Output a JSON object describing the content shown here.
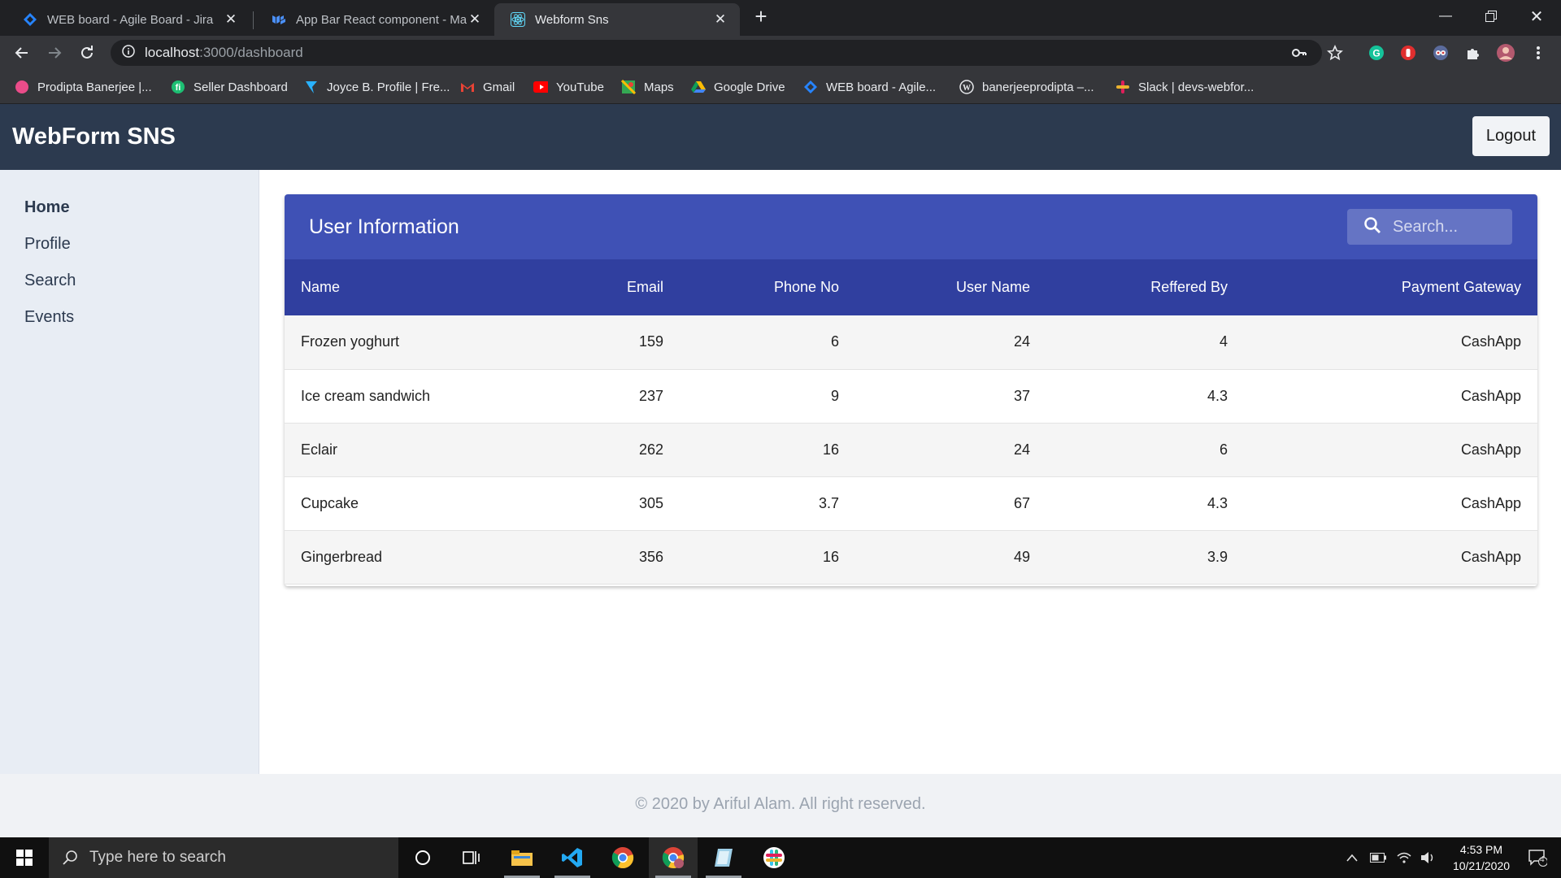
{
  "browser": {
    "tabs": [
      {
        "title": "WEB board - Agile Board - Jira",
        "icon": "jira-icon",
        "active": false
      },
      {
        "title": "App Bar React component - Mat",
        "icon": "material-ui-icon",
        "active": false
      },
      {
        "title": "Webform Sns",
        "icon": "react-icon",
        "active": true
      }
    ],
    "url_host": "localhost",
    "url_path": ":3000/dashboard",
    "bookmarks": [
      {
        "label": "Prodipta Banerjee |...",
        "icon": "dribbble-icon"
      },
      {
        "label": "Seller Dashboard",
        "icon": "fiverr-icon"
      },
      {
        "label": "Joyce B. Profile | Fre...",
        "icon": "freelancer-icon"
      },
      {
        "label": "Gmail",
        "icon": "gmail-icon"
      },
      {
        "label": "YouTube",
        "icon": "youtube-icon"
      },
      {
        "label": "Maps",
        "icon": "maps-icon"
      },
      {
        "label": "Google Drive",
        "icon": "drive-icon"
      },
      {
        "label": "WEB board - Agile...",
        "icon": "jira-icon"
      },
      {
        "label": "banerjeeprodipta –...",
        "icon": "wordpress-icon"
      },
      {
        "label": "Slack | devs-webfor...",
        "icon": "slack-icon"
      }
    ]
  },
  "app": {
    "brand": "WebForm SNS",
    "logout_label": "Logout",
    "sidebar": [
      {
        "label": "Home",
        "active": true
      },
      {
        "label": "Profile",
        "active": false
      },
      {
        "label": "Search",
        "active": false
      },
      {
        "label": "Events",
        "active": false
      }
    ],
    "card": {
      "title": "User Information",
      "search_placeholder": "Search...",
      "columns": [
        "Name",
        "Email",
        "Phone No",
        "User Name",
        "Reffered By",
        "Payment Gateway"
      ],
      "rows": [
        [
          "Frozen yoghurt",
          "159",
          "6",
          "24",
          "4",
          "CashApp"
        ],
        [
          "Ice cream sandwich",
          "237",
          "9",
          "37",
          "4.3",
          "CashApp"
        ],
        [
          "Eclair",
          "262",
          "16",
          "24",
          "6",
          "CashApp"
        ],
        [
          "Cupcake",
          "305",
          "3.7",
          "67",
          "4.3",
          "CashApp"
        ],
        [
          "Gingerbread",
          "356",
          "16",
          "49",
          "3.9",
          "CashApp"
        ]
      ]
    },
    "footer": "© 2020 by Ariful Alam. All right reserved."
  },
  "taskbar": {
    "search_placeholder": "Type here to search",
    "time": "4:53 PM",
    "date": "10/21/2020",
    "notification_count": "4"
  },
  "colors": {
    "appbar": "#2c3a4f",
    "card_header": "#3f51b5",
    "table_header": "#303f9f",
    "sidebar": "#e8edf4"
  }
}
